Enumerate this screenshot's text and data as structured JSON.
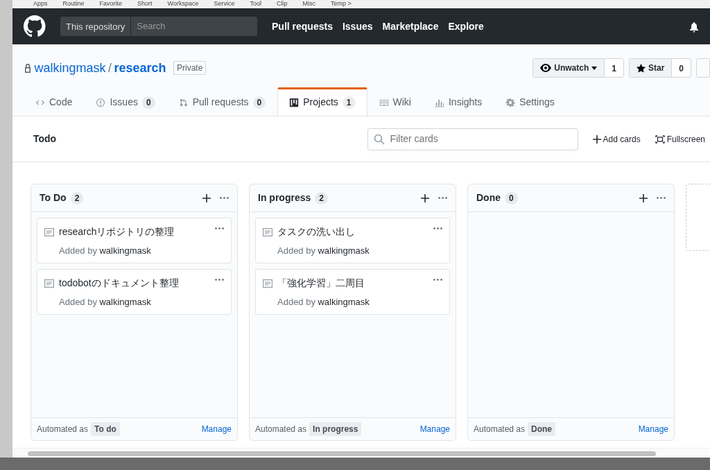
{
  "bookmarks": [
    "Apps",
    "Routine",
    "Favorite",
    "Short",
    "Workspace",
    "Service",
    "Tool",
    "Clip",
    "Misc",
    "Temp >"
  ],
  "header": {
    "scope": "This repository",
    "search_placeholder": "Search",
    "nav": [
      "Pull requests",
      "Issues",
      "Marketplace",
      "Explore"
    ]
  },
  "repo": {
    "owner": "walkingmask",
    "separator": "/",
    "name": "research",
    "visibility": "Private",
    "actions": [
      {
        "label": "Unwatch",
        "count": "1",
        "kind": "watch"
      },
      {
        "label": "Star",
        "count": "0",
        "kind": "star"
      }
    ]
  },
  "tabs": [
    {
      "label": "Code",
      "kind": "code",
      "selected": false
    },
    {
      "label": "Issues",
      "kind": "issue",
      "count": "0",
      "selected": false
    },
    {
      "label": "Pull requests",
      "kind": "pr",
      "count": "0",
      "selected": false
    },
    {
      "label": "Projects",
      "kind": "project",
      "count": "1",
      "selected": true
    },
    {
      "label": "Wiki",
      "kind": "book",
      "selected": false
    },
    {
      "label": "Insights",
      "kind": "graph",
      "selected": false
    },
    {
      "label": "Settings",
      "kind": "gear",
      "selected": false
    }
  ],
  "project": {
    "title": "Todo",
    "filter_placeholder": "Filter cards",
    "add_cards": "Add cards",
    "fullscreen": "Fullscreen"
  },
  "columns": [
    {
      "name": "To Do",
      "count": "2",
      "automated_label": "Automated as",
      "automated_as": "To do",
      "manage": "Manage",
      "cards": [
        {
          "title": "researchリポジトリの整理",
          "added_label": "Added by",
          "author": "walkingmask"
        },
        {
          "title": "todobotのドキュメント整理",
          "added_label": "Added by",
          "author": "walkingmask"
        }
      ]
    },
    {
      "name": "In progress",
      "count": "2",
      "automated_label": "Automated as",
      "automated_as": "In progress",
      "manage": "Manage",
      "cards": [
        {
          "title": "タスクの洗い出し",
          "added_label": "Added by",
          "author": "walkingmask"
        },
        {
          "title": "「強化学習」二周目",
          "added_label": "Added by",
          "author": "walkingmask"
        }
      ]
    },
    {
      "name": "Done",
      "count": "0",
      "automated_label": "Automated as",
      "automated_as": "Done",
      "manage": "Manage"
    }
  ]
}
